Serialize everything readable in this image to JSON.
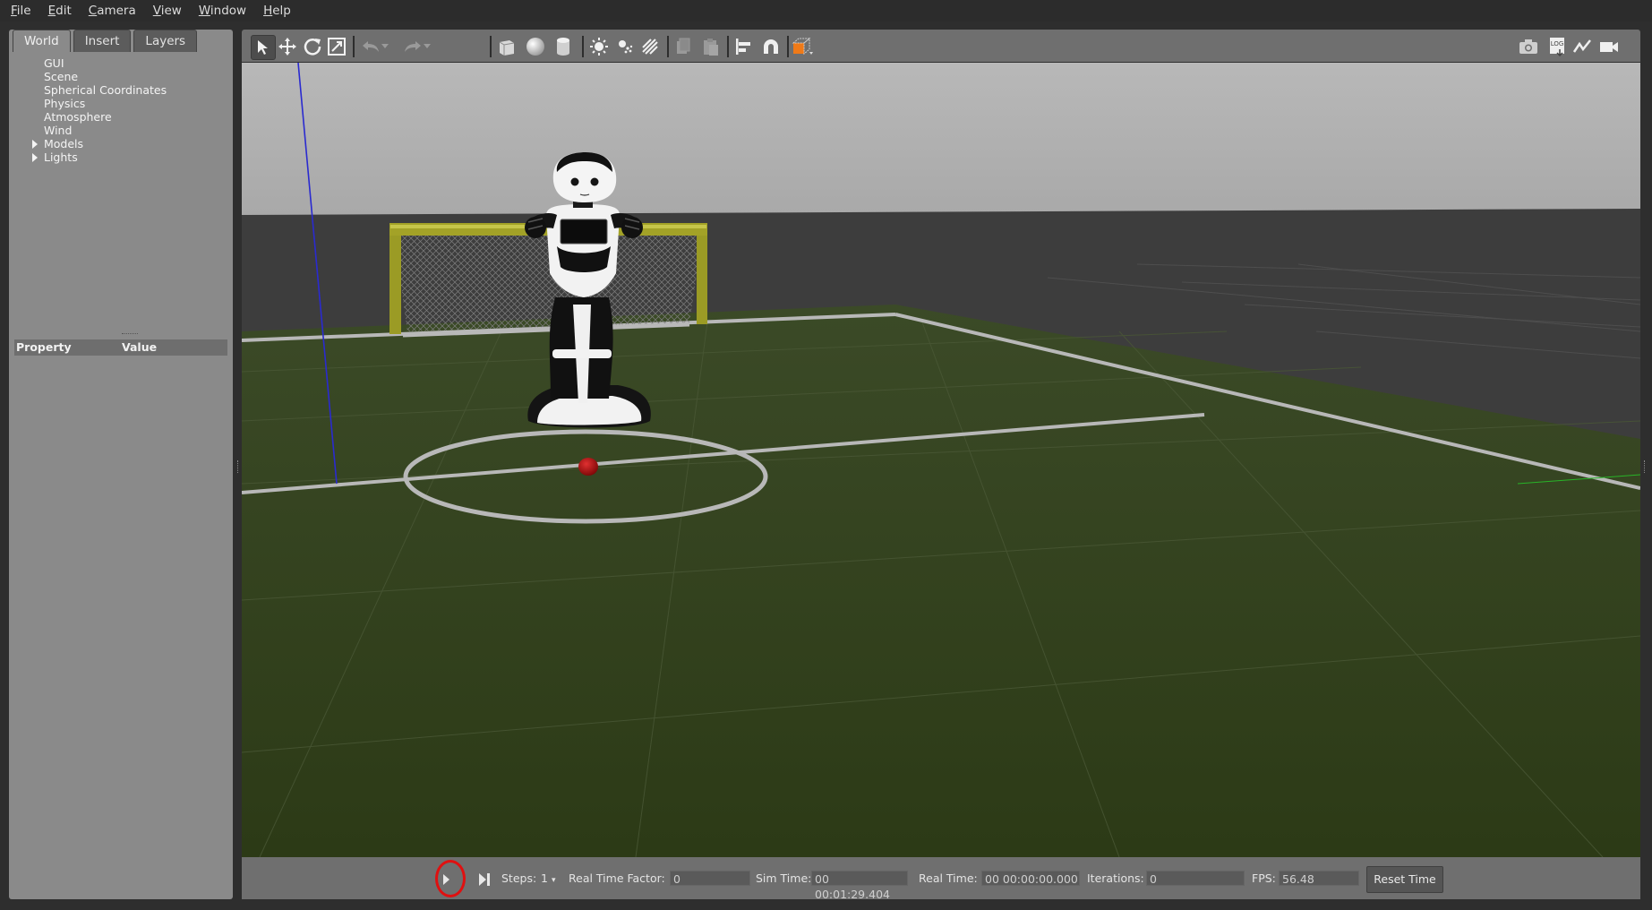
{
  "menu": {
    "items": [
      {
        "label": "File",
        "mnemonic": "F",
        "rest": "ile"
      },
      {
        "label": "Edit",
        "mnemonic": "E",
        "rest": "dit"
      },
      {
        "label": "Camera",
        "mnemonic": "C",
        "rest": "amera"
      },
      {
        "label": "View",
        "mnemonic": "V",
        "rest": "iew"
      },
      {
        "label": "Window",
        "mnemonic": "W",
        "rest": "indow"
      },
      {
        "label": "Help",
        "mnemonic": "H",
        "rest": "elp"
      }
    ]
  },
  "left_panel": {
    "tabs": [
      "World",
      "Insert",
      "Layers"
    ],
    "active_tab": "World",
    "tree": [
      {
        "label": "GUI",
        "expandable": false
      },
      {
        "label": "Scene",
        "expandable": false
      },
      {
        "label": "Spherical Coordinates",
        "expandable": false
      },
      {
        "label": "Physics",
        "expandable": false
      },
      {
        "label": "Atmosphere",
        "expandable": false
      },
      {
        "label": "Wind",
        "expandable": false
      },
      {
        "label": "Models",
        "expandable": true
      },
      {
        "label": "Lights",
        "expandable": true
      }
    ],
    "property_header": {
      "property": "Property",
      "value": "Value"
    }
  },
  "toolbar": {
    "left_tools": [
      "select-mode-icon",
      "translate-mode-icon",
      "rotate-mode-icon",
      "scale-mode-icon",
      "undo-icon",
      "undo-history-icon",
      "redo-icon",
      "redo-history-icon",
      "box-shape-icon",
      "sphere-shape-icon",
      "cylinder-shape-icon",
      "point-light-icon",
      "spot-light-icon",
      "directional-light-icon",
      "copy-icon",
      "paste-icon",
      "align-icon",
      "snap-icon",
      "view-angle-icon"
    ],
    "right_tools": [
      "screenshot-icon",
      "log-icon",
      "plot-icon",
      "video-record-icon"
    ],
    "active_tool": "select-mode-icon",
    "log_label": "LOG"
  },
  "bottom_bar": {
    "steps_label": "Steps:",
    "steps_value": "1",
    "rtf_label": "Real Time Factor:",
    "rtf_value": "0",
    "sim_time_label": "Sim Time:",
    "sim_time_value": "00 00:01:29.404",
    "real_time_label": "Real Time:",
    "real_time_value": "00 00:00:00.000",
    "iterations_label": "Iterations:",
    "iterations_value": "0",
    "fps_label": "FPS:",
    "fps_value": "56.48",
    "reset_label": "Reset Time"
  },
  "colors": {
    "highlight": "#e01010",
    "field_grass": "#36461f",
    "goal_post": "#a3a227",
    "ball": "#b40c0c",
    "sky": "#b4b4b4"
  }
}
